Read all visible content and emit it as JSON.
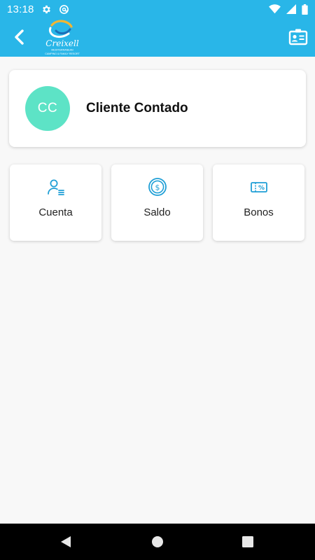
{
  "status_bar": {
    "time": "13:18",
    "icons": [
      "gear-icon",
      "vpn-at-icon",
      "wifi-icon",
      "cellular-signal-icon",
      "battery-icon"
    ]
  },
  "app_bar": {
    "back_icon": "chevron-left-icon",
    "logo_text": "Creixell",
    "logo_subtext": "MEDITERRANEAN",
    "logo_tagline": "CAMPING & FAMILY RESORT",
    "action_icon": "id-card-icon"
  },
  "profile": {
    "initials": "CC",
    "name": "Cliente Contado",
    "avatar_color": "#5de3c6"
  },
  "tiles": [
    {
      "label": "Cuenta",
      "icon": "user-list-icon"
    },
    {
      "label": "Saldo",
      "icon": "dollar-coin-icon"
    },
    {
      "label": "Bonos",
      "icon": "percent-ticket-icon"
    }
  ],
  "colors": {
    "primary": "#29b6e8",
    "icon_accent": "#1f9fd6",
    "background": "#f8f8f8"
  },
  "nav_bar": {
    "icons": [
      "nav-back-icon",
      "nav-home-icon",
      "nav-recents-icon"
    ]
  }
}
